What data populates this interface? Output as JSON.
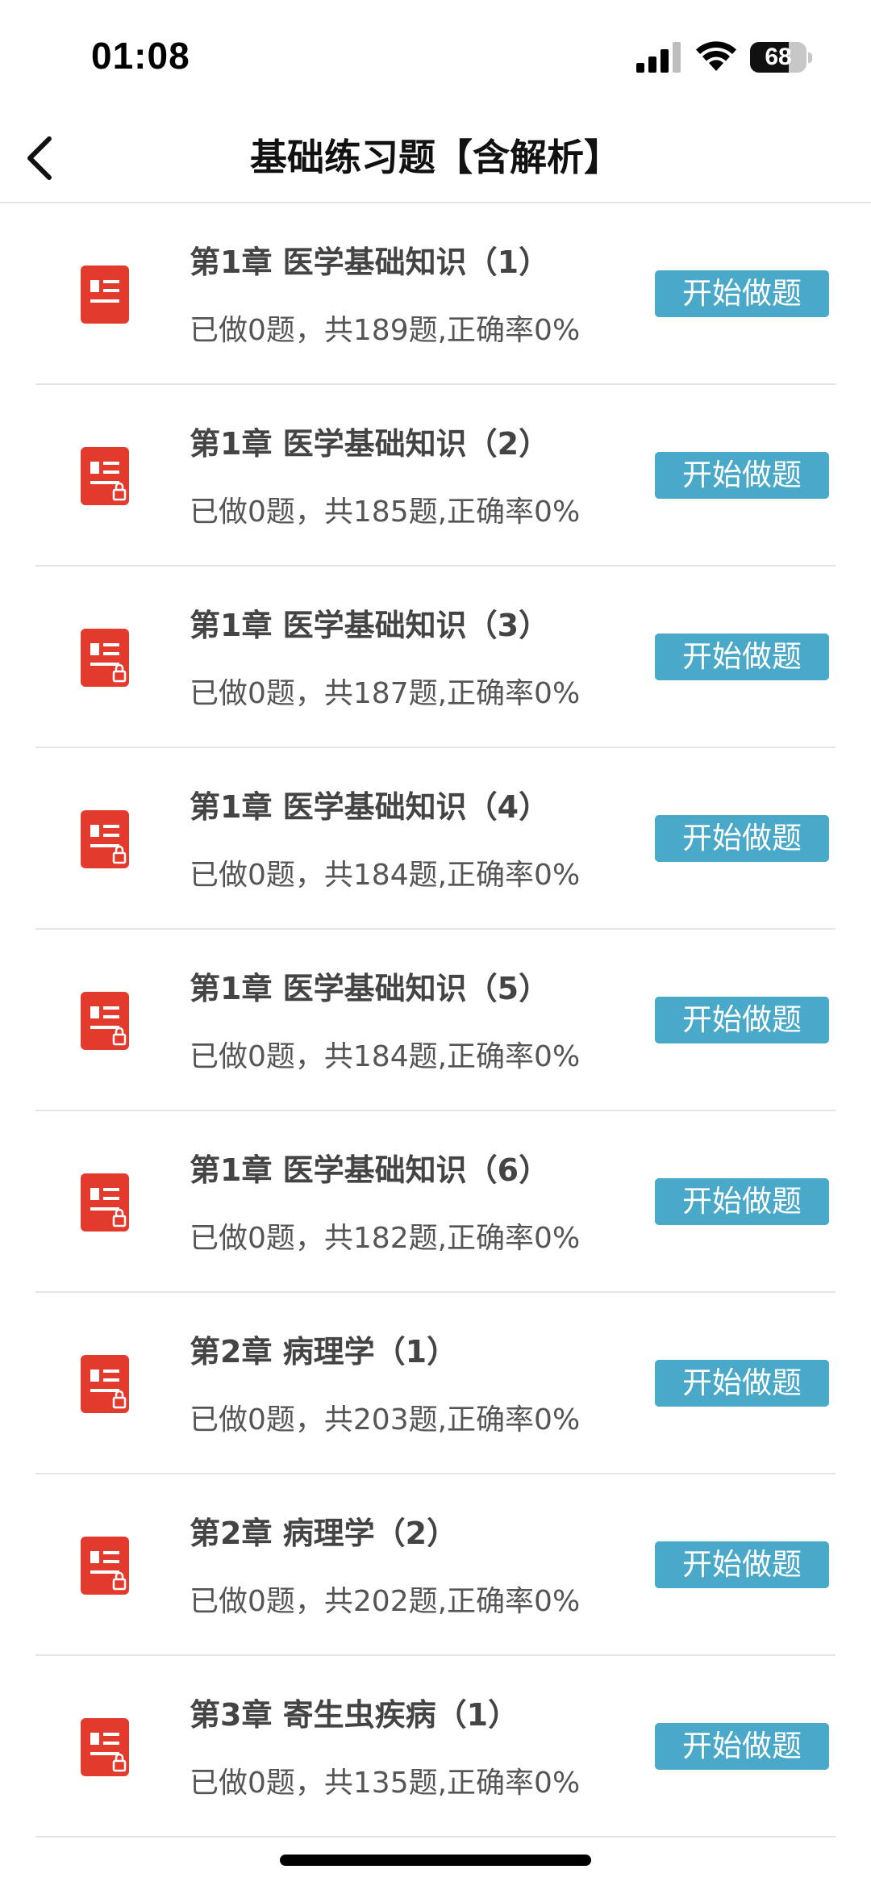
{
  "status_bar": {
    "time": "01:08",
    "battery_percent": "68",
    "battery_level": 0.68
  },
  "nav": {
    "title": "基础练习题【含解析】"
  },
  "colors": {
    "accent": "#4aa8c8",
    "icon_red": "#e23b2e"
  },
  "items": [
    {
      "title": "第1章  医学基础知识（1）",
      "subtitle": "已做0题，共189题,正确率0%",
      "button": "开始做题",
      "locked": false
    },
    {
      "title": "第1章  医学基础知识（2）",
      "subtitle": "已做0题，共185题,正确率0%",
      "button": "开始做题",
      "locked": true
    },
    {
      "title": "第1章  医学基础知识（3）",
      "subtitle": "已做0题，共187题,正确率0%",
      "button": "开始做题",
      "locked": true
    },
    {
      "title": "第1章  医学基础知识（4）",
      "subtitle": "已做0题，共184题,正确率0%",
      "button": "开始做题",
      "locked": true
    },
    {
      "title": "第1章  医学基础知识（5）",
      "subtitle": "已做0题，共184题,正确率0%",
      "button": "开始做题",
      "locked": true
    },
    {
      "title": "第1章  医学基础知识（6）",
      "subtitle": "已做0题，共182题,正确率0%",
      "button": "开始做题",
      "locked": true
    },
    {
      "title": "第2章  病理学（1）",
      "subtitle": "已做0题，共203题,正确率0%",
      "button": "开始做题",
      "locked": true
    },
    {
      "title": "第2章  病理学（2）",
      "subtitle": "已做0题，共202题,正确率0%",
      "button": "开始做题",
      "locked": true
    },
    {
      "title": "第3章  寄生虫疾病（1）",
      "subtitle": "已做0题，共135题,正确率0%",
      "button": "开始做题",
      "locked": true
    }
  ]
}
